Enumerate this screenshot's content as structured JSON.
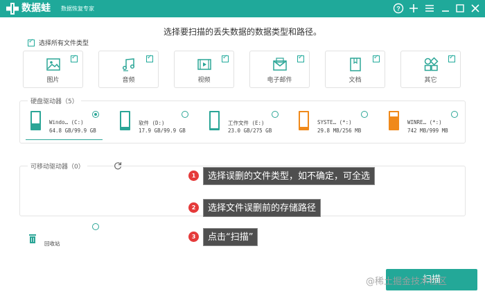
{
  "app": {
    "name": "数据蛙",
    "subtitle": "数据恢复专家"
  },
  "titlebar_icons": [
    "help-circle-icon",
    "plus-icon",
    "menu-icon",
    "minimize-icon",
    "maximize-icon",
    "close-icon"
  ],
  "prompt": "选择要扫描的丢失数据的数据类型和路径。",
  "select_all": {
    "label": "选择所有文件类型",
    "checked": true
  },
  "file_types": [
    {
      "label": "图片",
      "icon": "image-icon",
      "checked": true
    },
    {
      "label": "音频",
      "icon": "music-icon",
      "checked": true
    },
    {
      "label": "视频",
      "icon": "video-icon",
      "checked": true
    },
    {
      "label": "电子邮件",
      "icon": "email-icon",
      "checked": true
    },
    {
      "label": "文档",
      "icon": "document-icon",
      "checked": true
    },
    {
      "label": "其它",
      "icon": "other-icon",
      "checked": true
    }
  ],
  "hard_drives": {
    "title": "硬盘驱动器（5）",
    "items": [
      {
        "name": "Windo… (C:)",
        "size": "64.8 GB/99.9 GB",
        "fill": 0.35,
        "color": "#2aa596",
        "selected": true
      },
      {
        "name": "软件 (D:)",
        "size": "17.9 GB/99.9 GB",
        "fill": 0.12,
        "color": "#2aa596",
        "selected": false
      },
      {
        "name": "工作文件 (E:)",
        "size": "23.0 GB/275 GB",
        "fill": 0.06,
        "color": "#2aa596",
        "selected": false
      },
      {
        "name": "SYSTE… (*:)",
        "size": "29.8 MB/256 MB",
        "fill": 0.12,
        "color": "#f0891a",
        "selected": false
      },
      {
        "name": "WINRE… (*:)",
        "size": "742 MB/999 MB",
        "fill": 0.74,
        "color": "#f0891a",
        "selected": false
      }
    ]
  },
  "removable": {
    "title": "可移动驱动器（0）"
  },
  "recycle_bin": {
    "label": "回收站"
  },
  "callouts": [
    {
      "num": "1",
      "text": "选择误删的文件类型，如不确定，可全选"
    },
    {
      "num": "2",
      "text": "选择文件误删前的存储路径"
    },
    {
      "num": "3",
      "text": "点击“扫描”"
    }
  ],
  "scan_button": {
    "label": "扫描"
  },
  "watermark": "@稀土掘金技术社区",
  "colors": {
    "accent": "#1fa99a",
    "warning": "#f0891a",
    "callout_badge": "#e53a3a",
    "callout_bg": "#4f4f4f"
  }
}
